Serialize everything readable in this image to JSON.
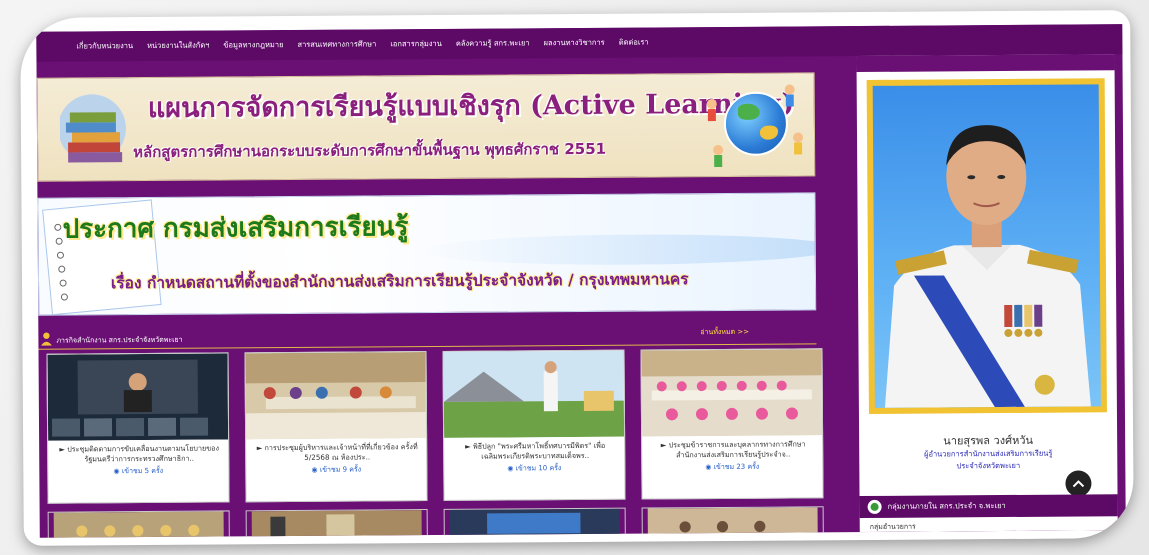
{
  "nav": {
    "items": [
      "เกี่ยวกับหน่วยงาน",
      "หน่วยงานในสังกัดฯ",
      "ข้อมูลทางกฎหมาย",
      "สารสนเทศทางการศึกษา",
      "เอกสารกลุ่มงาน",
      "คลังความรู้ สกร.พะเยา",
      "ผลงานทางวิชาการ",
      "ติดต่อเรา"
    ]
  },
  "banner1": {
    "title": "แผนการจัดการเรียนรู้แบบเชิงรุก (Active Learning)",
    "subtitle": "หลักสูตรการศึกษานอกระบบระดับการศึกษาขั้นพื้นฐาน พุทธศักราช 2551"
  },
  "banner2": {
    "title": "ประกาศ กรมส่งเสริมการเรียนรู้",
    "subtitle": "เรื่อง กำหนดสถานที่ตั้งของสำนักงานส่งเสริมการเรียนรู้ประจำจังหวัด / กรุงเทพมหานคร"
  },
  "section": {
    "title": "ภารกิจสำนักงาน สกร.ประจำจังหวัดพะเยา",
    "more": "อ่านทั้งหมด >>"
  },
  "cards": [
    {
      "title": "► ประชุมติดตามการขับเคลื่อนงานตามนโยบายของรัฐมนตรีว่าการกระทรวงศึกษาธิกา..",
      "views": "◉ เข้าชม 5 ครั้ง"
    },
    {
      "title": "► การประชุมผู้บริหารและเจ้าหน้าที่ที่เกี่ยวข้อง ครั้งที่ 5/2568 ณ ห้องประ..",
      "views": "◉ เข้าชม 9 ครั้ง"
    },
    {
      "title": "► พิธีปลูก \"พระศรีมหาโพธิ์ทศบารมีพิตร\" เพื่อเฉลิมพระเกียรติพระบาทสมเด็จพร..",
      "views": "◉ เข้าชม 10 ครั้ง"
    },
    {
      "title": "► ประชุมข้าราชการและบุคลากรทางการศึกษา สำนักงานส่งเสริมการเรียนรู้ประจำจ..",
      "views": "◉ เข้าชม 23 ครั้ง"
    }
  ],
  "sidebar": {
    "person_name": "นายสุรพล วงศ์หวัน",
    "person_title_line1": "ผู้อำนวยการสำนักงานส่งเสริมการเรียนรู้",
    "person_title_line2": "ประจำจังหวัดพะเยา",
    "group_title": "กลุ่มงานภายใน สกร.ประจำ จ.พะเยา",
    "group_item": "กลุ่มอำนวยการ"
  },
  "colors": {
    "page_bg": "#6a0f74",
    "nav_bg": "#5c0a66",
    "accent_gold": "#f1c232",
    "link_blue": "#2a62c9"
  }
}
